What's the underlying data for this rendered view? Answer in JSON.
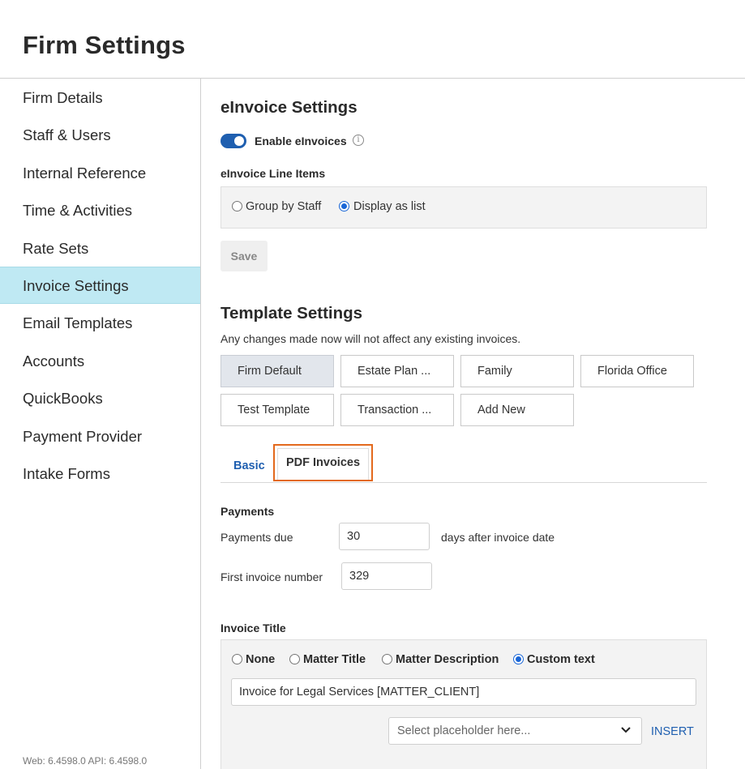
{
  "page": {
    "title": "Firm Settings"
  },
  "sidebar": {
    "items": [
      {
        "label": "Firm Details"
      },
      {
        "label": "Staff & Users"
      },
      {
        "label": "Internal Reference"
      },
      {
        "label": "Time & Activities"
      },
      {
        "label": "Rate Sets"
      },
      {
        "label": "Invoice Settings",
        "active": true
      },
      {
        "label": "Email Templates"
      },
      {
        "label": "Accounts"
      },
      {
        "label": "QuickBooks"
      },
      {
        "label": "Payment Provider"
      },
      {
        "label": "Intake Forms"
      }
    ],
    "version": "Web: 6.4598.0 API: 6.4598.0"
  },
  "einvoice": {
    "heading": "eInvoice Settings",
    "enable_label": "Enable eInvoices",
    "enabled": true,
    "info_icon": "info-icon",
    "line_items_label": "eInvoice Line Items",
    "options": [
      "Group by Staff",
      "Display as list"
    ],
    "selected": "Display as list",
    "save_label": "Save"
  },
  "template": {
    "heading": "Template Settings",
    "note": "Any changes made now will not affect any existing invoices.",
    "buttons": [
      "Firm Default",
      "Estate Plan ...",
      "Family",
      "Florida Office",
      "Test Template",
      "Transaction ...",
      "Add New"
    ],
    "active": "Firm Default"
  },
  "tabs": {
    "basic": "Basic",
    "pdf": "PDF Invoices",
    "active": "PDF Invoices"
  },
  "payments": {
    "heading": "Payments",
    "due_label": "Payments due",
    "due_value": "30",
    "due_suffix": "days after invoice date",
    "first_number_label": "First invoice number",
    "first_number_value": "329"
  },
  "invoice_title": {
    "heading": "Invoice Title",
    "options": [
      "None",
      "Matter Title",
      "Matter Description",
      "Custom text"
    ],
    "selected": "Custom text",
    "custom_value": "Invoice for Legal Services [MATTER_CLIENT]",
    "placeholder_select": "Select placeholder here...",
    "insert_label": "INSERT"
  },
  "colors": {
    "accent": "#1f5fb0",
    "active_nav": "#bfe9f3",
    "highlight_outline": "#e3691d"
  }
}
